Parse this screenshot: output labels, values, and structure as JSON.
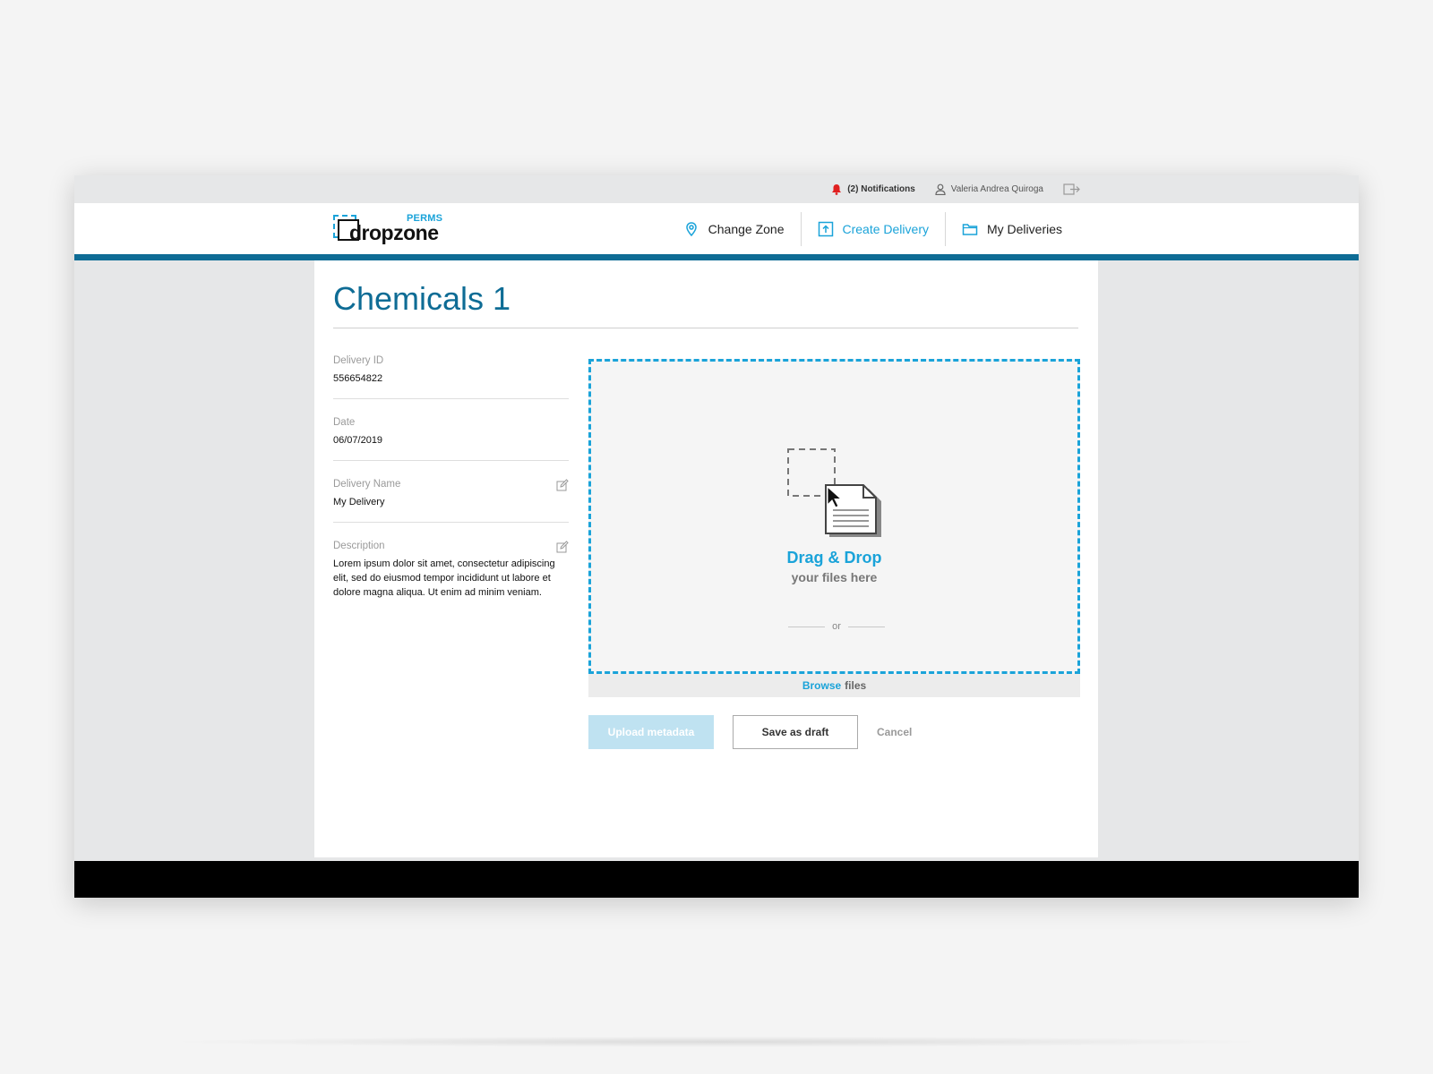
{
  "topbar": {
    "notifications": "(2) Notifications",
    "user_name": "Valeria Andrea Quiroga",
    "icons": [
      "bell-icon",
      "user-icon",
      "logout-icon"
    ]
  },
  "header": {
    "logo_main": "dropzone",
    "logo_tag": "PERMS",
    "nav": [
      {
        "label": "Change Zone",
        "icon": "location-pin-icon",
        "active": false
      },
      {
        "label": "Create Delivery",
        "icon": "upload-icon",
        "active": true
      },
      {
        "label": "My Deliveries",
        "icon": "folder-icon",
        "active": false
      }
    ]
  },
  "page": {
    "title": "Chemicals 1"
  },
  "fields": [
    {
      "label": "Delivery ID",
      "value": "556654822",
      "editable": false
    },
    {
      "label": "Date",
      "value": "06/07/2019",
      "editable": false
    },
    {
      "label": "Delivery Name",
      "value": "My Delivery",
      "editable": true
    },
    {
      "label": "Description",
      "value": "Lorem ipsum dolor sit amet, consectetur adipiscing elit, sed do eiusmod tempor incididunt ut labore et dolore magna aliqua. Ut enim ad minim veniam.",
      "editable": true
    }
  ],
  "dropzone": {
    "title": "Drag & Drop",
    "subtitle": "your files here",
    "or": "or",
    "browse_link": "Browse",
    "browse_rest": "files"
  },
  "actions": {
    "upload": "Upload metadata",
    "save_draft": "Save as draft",
    "cancel": "Cancel"
  },
  "colors": {
    "accent": "#1aa3d9",
    "brand_dark": "#0e6c95",
    "notification": "#e02020",
    "upload_disabled": "#bfe2f1"
  }
}
